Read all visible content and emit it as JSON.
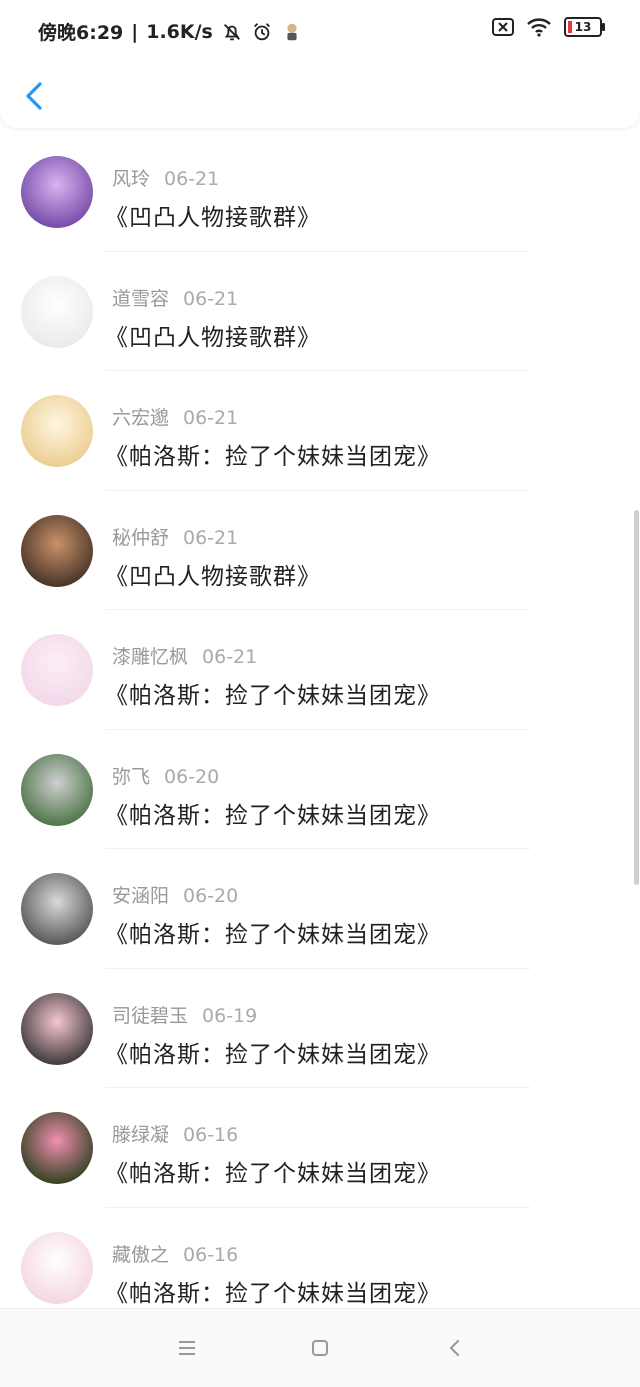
{
  "status_bar": {
    "time": "傍晚6:29",
    "speed": "1.6K/s",
    "battery": "13",
    "separator": "|"
  },
  "header": {
    "back_icon": "chevron-left-icon"
  },
  "comments": [
    {
      "name": "风玲",
      "date": "06-21",
      "text": "《凹凸人物接歌群》",
      "avatar_colors": [
        "#6a3fa0",
        "#d8b4f0"
      ]
    },
    {
      "name": "道雪容",
      "date": "06-21",
      "text": "《凹凸人物接歌群》",
      "avatar_colors": [
        "#e8e8e8",
        "#ffffff"
      ]
    },
    {
      "name": "六宏邈",
      "date": "06-21",
      "text": "《帕洛斯：捡了个妹妹当团宠》",
      "avatar_colors": [
        "#e9c98a",
        "#fff6e0"
      ]
    },
    {
      "name": "秘仲舒",
      "date": "06-21",
      "text": "《凹凸人物接歌群》",
      "avatar_colors": [
        "#3a2a20",
        "#c9926a"
      ]
    },
    {
      "name": "漆雕忆枫",
      "date": "06-21",
      "text": "《帕洛斯：捡了个妹妹当团宠》",
      "avatar_colors": [
        "#f2d6e8",
        "#fbeef6"
      ]
    },
    {
      "name": "弥飞",
      "date": "06-20",
      "text": "《帕洛斯：捡了个妹妹当团宠》",
      "avatar_colors": [
        "#3f6b3a",
        "#cfcfcf"
      ]
    },
    {
      "name": "安涵阳",
      "date": "06-20",
      "text": "《帕洛斯：捡了个妹妹当团宠》",
      "avatar_colors": [
        "#4a4a4a",
        "#d9d9d9"
      ]
    },
    {
      "name": "司徒碧玉",
      "date": "06-19",
      "text": "《帕洛斯：捡了个妹妹当团宠》",
      "avatar_colors": [
        "#2b2b2b",
        "#f5c6d0"
      ]
    },
    {
      "name": "滕绿凝",
      "date": "06-16",
      "text": "《帕洛斯：捡了个妹妹当团宠》",
      "avatar_colors": [
        "#1e3a14",
        "#f28fb0"
      ]
    },
    {
      "name": "藏傲之",
      "date": "06-16",
      "text": "《帕洛斯：捡了个妹妹当团宠》",
      "avatar_colors": [
        "#f3d2dc",
        "#ffffff"
      ]
    }
  ],
  "navbar": {
    "menu_icon": "menu-icon",
    "home_icon": "home-square-icon",
    "back_icon": "back-triangle-icon"
  },
  "colors": {
    "accent": "#2196f3"
  }
}
